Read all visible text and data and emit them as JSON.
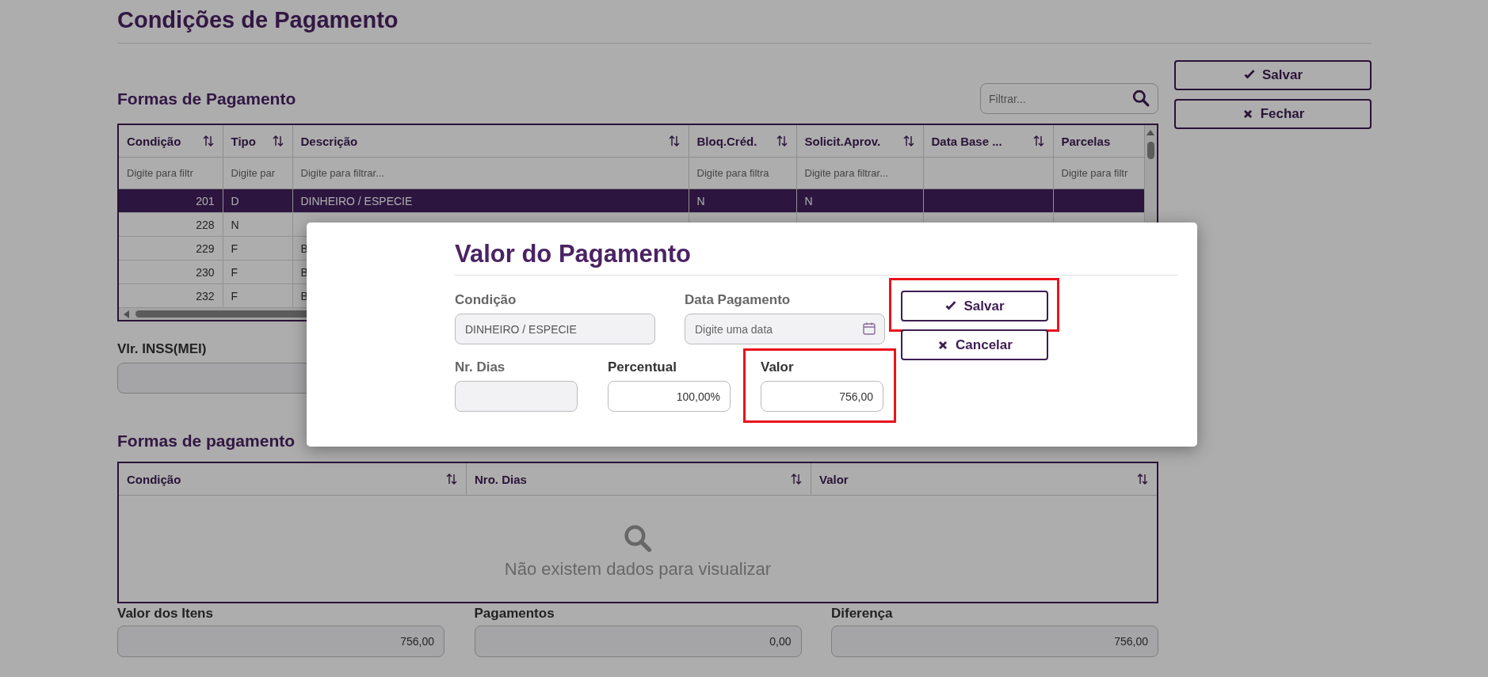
{
  "page": {
    "title": "Condições de Pagamento"
  },
  "actions": [
    {
      "label": "Salvar"
    },
    {
      "label": "Fechar"
    }
  ],
  "payment_methods": {
    "title": "Formas de Pagamento",
    "search": {
      "placeholder": "Filtrar..."
    },
    "columns": [
      {
        "label": "Condição",
        "kind": "number",
        "sortable": true,
        "filter_placeholder": "Digite para filtr"
      },
      {
        "label": "Tipo",
        "kind": "text",
        "sortable": true,
        "filter_placeholder": "Digite par"
      },
      {
        "label": "Descrição",
        "kind": "text",
        "sortable": true,
        "filter_placeholder": "Digite para filtrar..."
      },
      {
        "label": "Bloq.Créd.",
        "kind": "text",
        "sortable": true,
        "filter_placeholder": "Digite para filtra"
      },
      {
        "label": "Solicit.Aprov.",
        "kind": "text",
        "sortable": true,
        "filter_placeholder": "Digite para filtrar..."
      },
      {
        "label": "Data Base ...",
        "kind": "text",
        "sortable": true
      },
      {
        "label": "Parcelas",
        "kind": "text",
        "sortable": false,
        "filter_placeholder": "Digite para filtr"
      }
    ],
    "rows": [
      {
        "selected": true,
        "cells": [
          "201",
          "D",
          "DINHEIRO / ESPECIE",
          "N",
          "N"
        ]
      },
      {
        "selected": false,
        "cells": [
          "228",
          "N"
        ]
      },
      {
        "selected": false,
        "cells": [
          "229",
          "F",
          "B"
        ]
      },
      {
        "selected": false,
        "cells": [
          "230",
          "F",
          "B"
        ]
      },
      {
        "selected": false,
        "cells": [
          "232",
          "F",
          "B"
        ]
      }
    ]
  },
  "inss": {
    "label": "Vlr. INSS(MEI)"
  },
  "payments": {
    "title": "Formas de pagamento",
    "columns": [
      {
        "label": "Condição",
        "sortable": true
      },
      {
        "label": "Nro. Dias",
        "sortable": true
      },
      {
        "label": "Valor",
        "sortable": true
      }
    ],
    "empty_message": "Não existem dados para visualizar"
  },
  "totals": [
    {
      "label": "Valor dos Itens",
      "value": "756,00"
    },
    {
      "label": "Pagamentos",
      "value": "0,00"
    },
    {
      "label": "Diferença",
      "value": "756,00"
    }
  ],
  "modal": {
    "title": "Valor do Pagamento",
    "rows": [
      [
        {
          "kind": "text",
          "label": "Condição",
          "value": "DINHEIRO / ESPECIE",
          "disabled": true,
          "highlighted": false
        },
        {
          "kind": "date",
          "label": "Data Pagamento",
          "placeholder": "Digite uma data",
          "disabled": true,
          "highlighted": false
        }
      ],
      [
        {
          "kind": "text",
          "label": "Nr. Dias",
          "disabled": true,
          "highlighted": false
        },
        {
          "kind": "text",
          "label": "Percentual",
          "value": "100,00%",
          "disabled": false,
          "highlighted": false
        },
        {
          "kind": "text",
          "label": "Valor",
          "value": "756,00",
          "disabled": false,
          "highlighted": true
        }
      ]
    ],
    "buttons": [
      {
        "label": "Salvar",
        "highlighted": true
      },
      {
        "label": "Cancelar",
        "highlighted": false
      }
    ]
  }
}
